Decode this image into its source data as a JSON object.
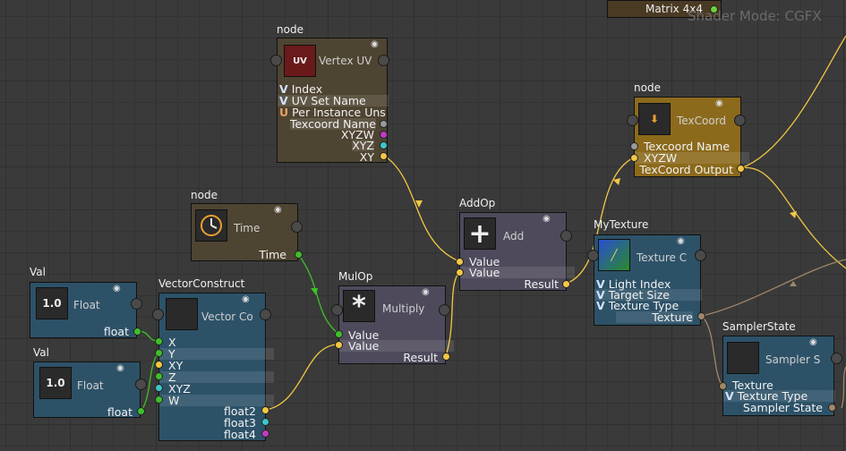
{
  "shader_mode": "Shader Mode: CGFX",
  "top_node": {
    "label": "Matrix 4x4"
  },
  "nodes": {
    "vertex_uv": {
      "title": "node",
      "type": "Vertex UV",
      "inputs": [
        "Index",
        "UV Set Name",
        "Per Instance Uns"
      ],
      "outputs": [
        "Texcoord Name",
        "XYZW",
        "XYZ",
        "XY"
      ]
    },
    "time": {
      "title": "node",
      "type": "Time",
      "outputs": [
        "Time"
      ]
    },
    "val1": {
      "title": "Val",
      "type": "Float",
      "value": "1.0",
      "outputs": [
        "float"
      ]
    },
    "val2": {
      "title": "Val",
      "type": "Float",
      "value": "1.0",
      "outputs": [
        "float"
      ]
    },
    "vector_construct": {
      "title": "VectorConstruct",
      "type": "Vector Co",
      "inputs": [
        "X",
        "Y",
        "XY",
        "Z",
        "XYZ",
        "W"
      ],
      "outputs": [
        "float2",
        "float3",
        "float4"
      ]
    },
    "mulop": {
      "title": "MulOp",
      "type": "Multiply",
      "symbol": "*",
      "inputs": [
        "Value",
        "Value"
      ],
      "outputs": [
        "Result"
      ]
    },
    "addop": {
      "title": "AddOp",
      "type": "Add",
      "symbol": "+",
      "inputs": [
        "Value",
        "Value"
      ],
      "outputs": [
        "Result"
      ]
    },
    "texcoord": {
      "title": "node",
      "type": "TexCoord",
      "inputs": [
        "Texcoord Name",
        "XYZW"
      ],
      "outputs": [
        "TexCoord Output"
      ]
    },
    "mytexture": {
      "title": "MyTexture",
      "type": "Texture C",
      "inputs": [
        "Light Index",
        "Target Size",
        "Texture Type"
      ],
      "outputs": [
        "Texture"
      ]
    },
    "sampler": {
      "title": "SamplerState",
      "type": "Sampler S",
      "inputs": [
        "Texture",
        "Texture Type"
      ],
      "outputs": [
        "Sampler State"
      ]
    }
  },
  "colors": {
    "float": "#3fbf2a",
    "vec2": "#f2c744",
    "vec3": "#3cc7c7",
    "vec4": "#c23bc2",
    "texture": "#a08868"
  }
}
